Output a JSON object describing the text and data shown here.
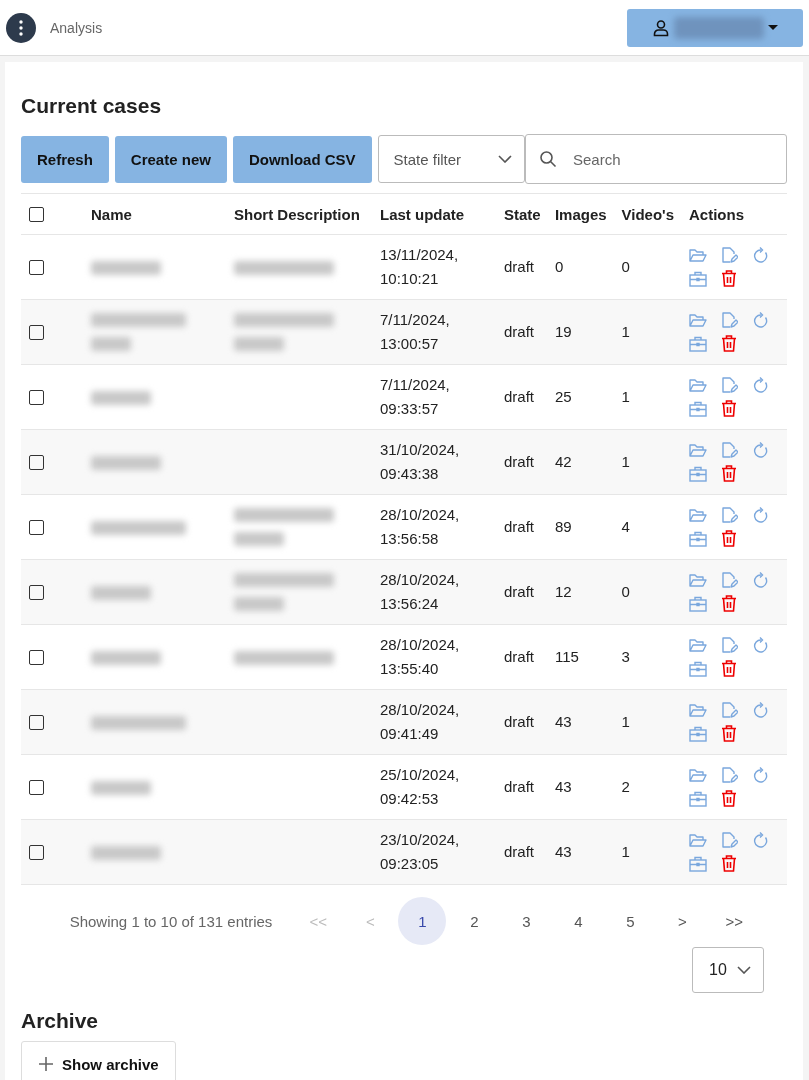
{
  "header": {
    "title": "Analysis",
    "user_name_redacted": true
  },
  "section_title": "Current cases",
  "buttons": [
    "Refresh",
    "Create new",
    "Download CSV"
  ],
  "state_filter": {
    "placeholder": "State filter"
  },
  "search": {
    "placeholder": "Search"
  },
  "table": {
    "select_all_checked": false,
    "columns": [
      "Name",
      "Short Description",
      "Last update",
      "State",
      "Images",
      "Video's",
      "Actions"
    ],
    "rows": [
      {
        "checked": false,
        "name_redacted": true,
        "name_wraps": false,
        "description_redacted": true,
        "description_wraps": false,
        "updated": "13/11/2024, 10:10:21",
        "state": "draft",
        "images": "0",
        "videos": "0"
      },
      {
        "checked": false,
        "name_redacted": true,
        "name_wraps": true,
        "description_redacted": true,
        "description_wraps": true,
        "updated": "7/11/2024, 13:00:57",
        "state": "draft",
        "images": "19",
        "videos": "1"
      },
      {
        "checked": false,
        "name_redacted": true,
        "name_wraps": false,
        "description_redacted": false,
        "updated": "7/11/2024, 09:33:57",
        "state": "draft",
        "images": "25",
        "videos": "1"
      },
      {
        "checked": false,
        "name_redacted": true,
        "name_wraps": false,
        "description_redacted": false,
        "updated": "31/10/2024, 09:43:38",
        "state": "draft",
        "images": "42",
        "videos": "1"
      },
      {
        "checked": false,
        "name_redacted": true,
        "name_wraps": false,
        "description_redacted": true,
        "description_wraps": true,
        "updated": "28/10/2024, 13:56:58",
        "state": "draft",
        "images": "89",
        "videos": "4"
      },
      {
        "checked": false,
        "name_redacted": true,
        "name_wraps": false,
        "description_redacted": true,
        "description_wraps": true,
        "updated": "28/10/2024, 13:56:24",
        "state": "draft",
        "images": "12",
        "videos": "0"
      },
      {
        "checked": false,
        "name_redacted": true,
        "name_wraps": false,
        "description_redacted": true,
        "description_wraps": false,
        "updated": "28/10/2024, 13:55:40",
        "state": "draft",
        "images": "115",
        "videos": "3"
      },
      {
        "checked": false,
        "name_redacted": true,
        "name_wraps": false,
        "description_redacted": false,
        "updated": "28/10/2024, 09:41:49",
        "state": "draft",
        "images": "43",
        "videos": "1"
      },
      {
        "checked": false,
        "name_redacted": true,
        "name_wraps": false,
        "description_redacted": false,
        "updated": "25/10/2024, 09:42:53",
        "state": "draft",
        "images": "43",
        "videos": "2"
      },
      {
        "checked": false,
        "name_redacted": true,
        "name_wraps": false,
        "description_redacted": false,
        "updated": "23/10/2024, 09:23:05",
        "state": "draft",
        "images": "43",
        "videos": "1"
      }
    ]
  },
  "pagination": {
    "summary": "Showing 1 to 10 of 131 entries",
    "items": [
      {
        "label": "<<",
        "selected": false,
        "disabled": true
      },
      {
        "label": "<",
        "selected": false,
        "disabled": true
      },
      {
        "label": "1",
        "selected": true,
        "disabled": false
      },
      {
        "label": "2",
        "selected": false,
        "disabled": false
      },
      {
        "label": "3",
        "selected": false,
        "disabled": false
      },
      {
        "label": "4",
        "selected": false,
        "disabled": false
      },
      {
        "label": "5",
        "selected": false,
        "disabled": false
      },
      {
        "label": ">",
        "selected": false,
        "disabled": false
      },
      {
        "label": ">>",
        "selected": false,
        "disabled": false
      }
    ],
    "page_size": "10"
  },
  "archive": {
    "title": "Archive",
    "button": "Show archive"
  }
}
